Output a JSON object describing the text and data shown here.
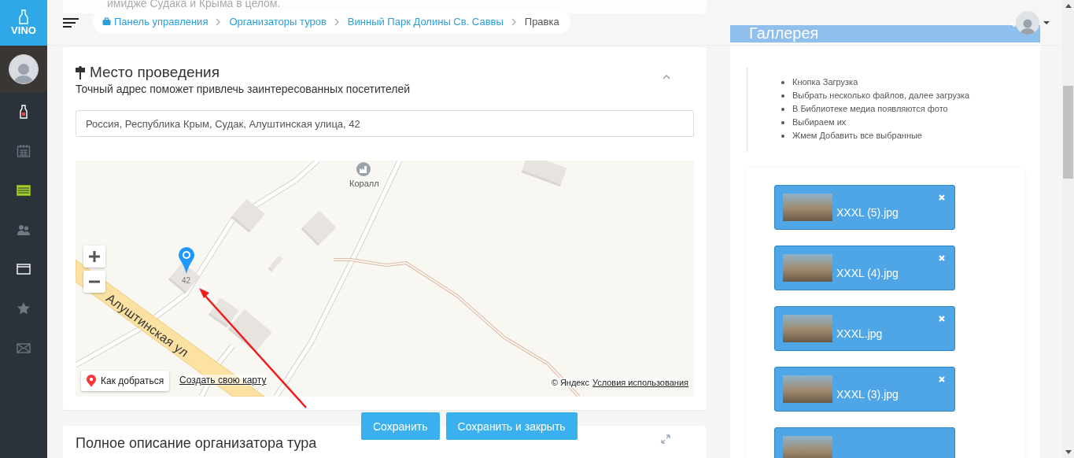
{
  "sidebar": {
    "logo": "VINO",
    "items": [
      {
        "kind": "bottle",
        "selected": false
      },
      {
        "kind": "calendar",
        "selected": false
      },
      {
        "kind": "list",
        "selected": true
      },
      {
        "kind": "users",
        "selected": false
      },
      {
        "kind": "window",
        "selected": false
      },
      {
        "kind": "star",
        "selected": false
      },
      {
        "kind": "envelope",
        "selected": false
      }
    ]
  },
  "header": {
    "breadcrumb": [
      {
        "label": "Панель управления",
        "kind": "home"
      },
      {
        "label": "Организаторы туров",
        "kind": "link"
      },
      {
        "label": "Винный Парк Долины Св. Саввы",
        "kind": "link"
      },
      {
        "label": "Правка",
        "kind": "current"
      }
    ]
  },
  "previous_text": "имидже Судака и Крыма в целом.",
  "venue": {
    "title": "Место проведения",
    "subtitle": "Точный адрес поможет привлечь заинтересованных посетителей",
    "address": "Россия, Республика Крым, Судак, Алуштинская улица, 42",
    "map": {
      "poi": "Коралл",
      "house": "42",
      "street": "Алуштинская ул",
      "route_button": "Как добраться",
      "create_link": "Создать свою карту",
      "copyright": "© Яндекс",
      "terms_link": "Условия использования"
    }
  },
  "actions": [
    "Сохранить",
    "Сохранить и закрыть"
  ],
  "description": {
    "title": "Полное описание организатора тура"
  },
  "gallery": {
    "title": "Галлерея",
    "instructions": [
      "Кнопка Загрузка",
      "Выбрать несколько файлов, далее загрузка",
      "В Библиотеке медиа появляются фото",
      "Выбираем их",
      "Жмем Добавить все выбранные"
    ],
    "files": [
      {
        "kind": "image",
        "name": "XXXL (5).jpg"
      },
      {
        "kind": "image",
        "name": "XXXL (4).jpg"
      },
      {
        "kind": "image",
        "name": "XXXL.jpg"
      },
      {
        "kind": "image",
        "name": "XXXL (3).jpg"
      },
      {
        "kind": "image"
      }
    ]
  }
}
